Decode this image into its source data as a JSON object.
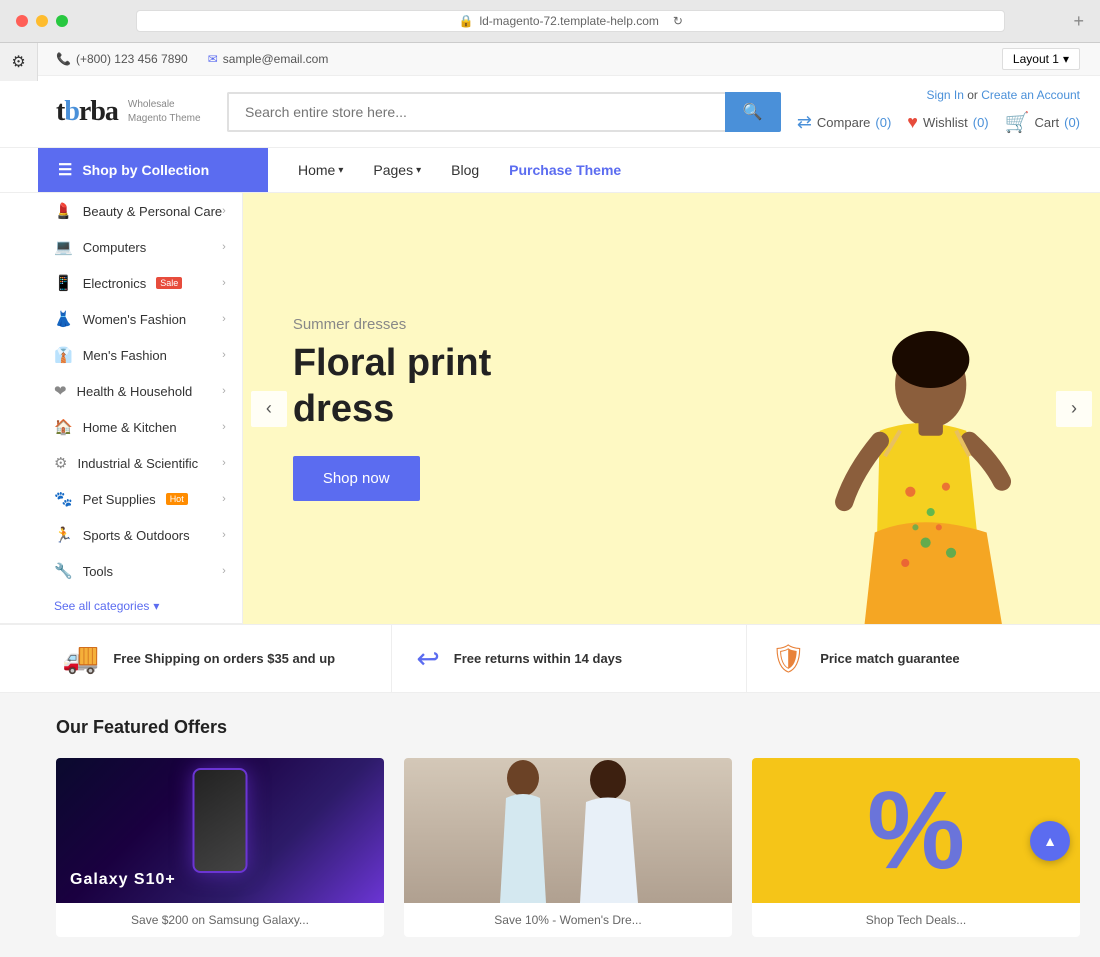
{
  "window": {
    "url": "ld-magento-72.template-help.com",
    "title": "Wholesale Magento Theme"
  },
  "topbar": {
    "phone_icon": "📞",
    "phone": "(+800) 123 456 7890",
    "email_icon": "✉",
    "email": "sample@email.com",
    "layout_label": "Layout 1"
  },
  "header": {
    "logo": "tbrba",
    "logo_subtitle_line1": "Wholesale",
    "logo_subtitle_line2": "Magento Theme",
    "search_placeholder": "Search entire store here...",
    "sign_in": "Sign In",
    "or_text": "or",
    "create_account": "Create an Account",
    "compare_label": "Compare",
    "compare_count": "(0)",
    "wishlist_label": "Wishlist",
    "wishlist_count": "(0)",
    "cart_label": "Cart",
    "cart_count": "(0)"
  },
  "nav": {
    "shop_by_label": "Shop by Collection",
    "links": [
      {
        "label": "Home",
        "has_arrow": true,
        "active": false
      },
      {
        "label": "Pages",
        "has_arrow": true,
        "active": false
      },
      {
        "label": "Blog",
        "has_arrow": false,
        "active": false
      },
      {
        "label": "Purchase Theme",
        "has_arrow": false,
        "active": true,
        "purchase": true
      }
    ]
  },
  "categories": [
    {
      "label": "Beauty & Personal Care",
      "icon": "💄",
      "badge": null
    },
    {
      "label": "Computers",
      "icon": "💻",
      "badge": null
    },
    {
      "label": "Electronics",
      "icon": "📱",
      "badge": "sale"
    },
    {
      "label": "Women's Fashion",
      "icon": "👗",
      "badge": null
    },
    {
      "label": "Men's Fashion",
      "icon": "👔",
      "badge": null
    },
    {
      "label": "Health & Household",
      "icon": "❤",
      "badge": null
    },
    {
      "label": "Home & Kitchen",
      "icon": "🏠",
      "badge": null
    },
    {
      "label": "Industrial & Scientific",
      "icon": "⚙",
      "badge": null
    },
    {
      "label": "Pet Supplies",
      "icon": "🐾",
      "badge": "hot"
    },
    {
      "label": "Sports & Outdoors",
      "icon": "🏃",
      "badge": null
    },
    {
      "label": "Tools",
      "icon": "🔧",
      "badge": null
    }
  ],
  "see_all": "See all categories",
  "hero": {
    "subtitle": "Summer dresses",
    "title_line1": "Floral print dress",
    "cta_label": "Shop now"
  },
  "features": [
    {
      "icon": "🚚",
      "title": "Free Shipping on orders $35 and up",
      "color": "#e8823a"
    },
    {
      "icon": "↩",
      "title": "Free returns within 14 days",
      "color": "#5b6cf0"
    },
    {
      "icon": "🛡",
      "title": "Price match guarantee",
      "color": "#e8823a"
    }
  ],
  "featured_section": {
    "title": "Our Featured Offers",
    "cards": [
      {
        "type": "galaxy",
        "label": "Save $200 on Samsung Galaxy...",
        "phone_text": "Galaxy S10+"
      },
      {
        "type": "fashion",
        "label": "Save 10% - Women's Dre..."
      },
      {
        "type": "deals",
        "label": "Shop Tech Deals..."
      }
    ]
  },
  "scroll_top_icon": "▲"
}
